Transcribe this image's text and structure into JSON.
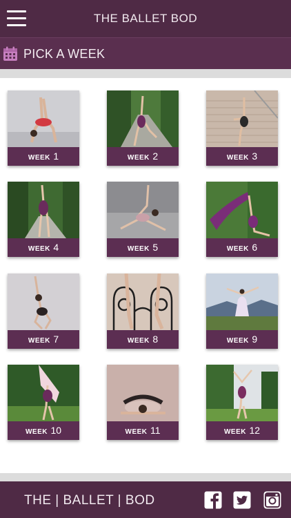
{
  "header": {
    "title": "THE BALLET BOD",
    "menu_icon": "hamburger-menu-icon"
  },
  "subheader": {
    "icon": "calendar-icon",
    "title": "PICK A WEEK",
    "icon_color": "#c77fc0"
  },
  "weeks": [
    {
      "prefix": "WEEK",
      "number": "1"
    },
    {
      "prefix": "WEEK",
      "number": "2"
    },
    {
      "prefix": "WEEK",
      "number": "3"
    },
    {
      "prefix": "WEEK",
      "number": "4"
    },
    {
      "prefix": "WEEK",
      "number": "5"
    },
    {
      "prefix": "WEEK",
      "number": "6"
    },
    {
      "prefix": "WEEK",
      "number": "7"
    },
    {
      "prefix": "WEEK",
      "number": "8"
    },
    {
      "prefix": "WEEK",
      "number": "9"
    },
    {
      "prefix": "WEEK",
      "number": "10"
    },
    {
      "prefix": "WEEK",
      "number": "11"
    },
    {
      "prefix": "WEEK",
      "number": "12"
    }
  ],
  "footer": {
    "brand": "THE | BALLET | BOD",
    "social": [
      "facebook-icon",
      "twitter-icon",
      "instagram-icon"
    ]
  },
  "colors": {
    "header_bg": "#4f2a45",
    "subheader_bg": "#5a2f4f",
    "tile_label_bg": "#5c2e52"
  }
}
